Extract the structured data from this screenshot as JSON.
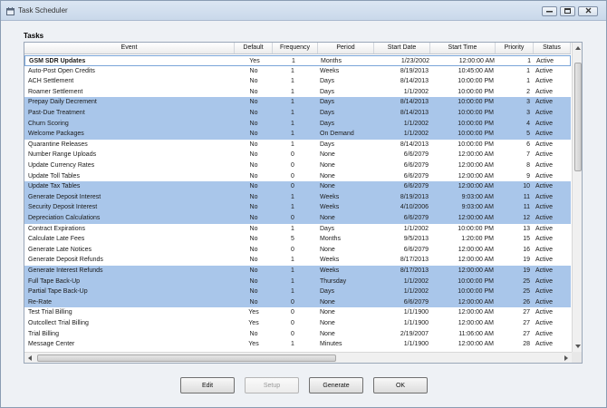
{
  "window": {
    "title": "Task Scheduler",
    "group_label": "Tasks"
  },
  "columns": {
    "event": "Event",
    "default": "Default",
    "frequency": "Frequency",
    "period": "Period",
    "start_date": "Start Date",
    "start_time": "Start Time",
    "priority": "Priority",
    "status": "Status"
  },
  "rows": [
    {
      "event": "GSM SDR Updates",
      "default": "Yes",
      "frequency": "1",
      "period": "Months",
      "start_date": "1/23/2002",
      "start_time": "12:00:00 AM",
      "priority": "1",
      "status": "Active",
      "highlight": false,
      "selected": true,
      "bold": true
    },
    {
      "event": "Auto-Post Open Credits",
      "default": "No",
      "frequency": "1",
      "period": "Weeks",
      "start_date": "8/19/2013",
      "start_time": "10:45:00 AM",
      "priority": "1",
      "status": "Active",
      "highlight": false
    },
    {
      "event": "ACH Settlement",
      "default": "No",
      "frequency": "1",
      "period": "Days",
      "start_date": "8/14/2013",
      "start_time": "10:00:00 PM",
      "priority": "1",
      "status": "Active",
      "highlight": false
    },
    {
      "event": "Roamer Settlement",
      "default": "No",
      "frequency": "1",
      "period": "Days",
      "start_date": "1/1/2002",
      "start_time": "10:00:00 PM",
      "priority": "2",
      "status": "Active",
      "highlight": false
    },
    {
      "event": "Prepay Daily Decrement",
      "default": "No",
      "frequency": "1",
      "period": "Days",
      "start_date": "8/14/2013",
      "start_time": "10:00:00 PM",
      "priority": "3",
      "status": "Active",
      "highlight": true
    },
    {
      "event": "Past-Due Treatment",
      "default": "No",
      "frequency": "1",
      "period": "Days",
      "start_date": "8/14/2013",
      "start_time": "10:00:00 PM",
      "priority": "3",
      "status": "Active",
      "highlight": true
    },
    {
      "event": "Churn Scoring",
      "default": "No",
      "frequency": "1",
      "period": "Days",
      "start_date": "1/1/2002",
      "start_time": "10:00:00 PM",
      "priority": "4",
      "status": "Active",
      "highlight": true
    },
    {
      "event": "Welcome Packages",
      "default": "No",
      "frequency": "1",
      "period": "On Demand",
      "start_date": "1/1/2002",
      "start_time": "10:00:00 PM",
      "priority": "5",
      "status": "Active",
      "highlight": true
    },
    {
      "event": "Quarantine Releases",
      "default": "No",
      "frequency": "1",
      "period": "Days",
      "start_date": "8/14/2013",
      "start_time": "10:00:00 PM",
      "priority": "6",
      "status": "Active",
      "highlight": false
    },
    {
      "event": "Number Range Uploads",
      "default": "No",
      "frequency": "0",
      "period": "None",
      "start_date": "6/6/2079",
      "start_time": "12:00:00 AM",
      "priority": "7",
      "status": "Active",
      "highlight": false
    },
    {
      "event": "Update Currency Rates",
      "default": "No",
      "frequency": "0",
      "period": "None",
      "start_date": "6/6/2079",
      "start_time": "12:00:00 AM",
      "priority": "8",
      "status": "Active",
      "highlight": false
    },
    {
      "event": "Update Toll Tables",
      "default": "No",
      "frequency": "0",
      "period": "None",
      "start_date": "6/6/2079",
      "start_time": "12:00:00 AM",
      "priority": "9",
      "status": "Active",
      "highlight": false
    },
    {
      "event": "Update Tax Tables",
      "default": "No",
      "frequency": "0",
      "period": "None",
      "start_date": "6/6/2079",
      "start_time": "12:00:00 AM",
      "priority": "10",
      "status": "Active",
      "highlight": true
    },
    {
      "event": "Generate Deposit Interest",
      "default": "No",
      "frequency": "1",
      "period": "Weeks",
      "start_date": "8/19/2013",
      "start_time": "9:03:00 AM",
      "priority": "11",
      "status": "Active",
      "highlight": true
    },
    {
      "event": "Security Deposit Interest",
      "default": "No",
      "frequency": "1",
      "period": "Weeks",
      "start_date": "4/10/2006",
      "start_time": "9:03:00 AM",
      "priority": "11",
      "status": "Active",
      "highlight": true
    },
    {
      "event": "Depreciation Calculations",
      "default": "No",
      "frequency": "0",
      "period": "None",
      "start_date": "6/6/2079",
      "start_time": "12:00:00 AM",
      "priority": "12",
      "status": "Active",
      "highlight": true
    },
    {
      "event": "Contract Expirations",
      "default": "No",
      "frequency": "1",
      "period": "Days",
      "start_date": "1/1/2002",
      "start_time": "10:00:00 PM",
      "priority": "13",
      "status": "Active",
      "highlight": false
    },
    {
      "event": "Calculate Late Fees",
      "default": "No",
      "frequency": "5",
      "period": "Months",
      "start_date": "9/5/2013",
      "start_time": "1:20:00 PM",
      "priority": "15",
      "status": "Active",
      "highlight": false
    },
    {
      "event": "Generate Late Notices",
      "default": "No",
      "frequency": "0",
      "period": "None",
      "start_date": "6/6/2079",
      "start_time": "12:00:00 AM",
      "priority": "16",
      "status": "Active",
      "highlight": false
    },
    {
      "event": "Generate Deposit Refunds",
      "default": "No",
      "frequency": "1",
      "period": "Weeks",
      "start_date": "8/17/2013",
      "start_time": "12:00:00 AM",
      "priority": "19",
      "status": "Active",
      "highlight": false
    },
    {
      "event": "Generate Interest Refunds",
      "default": "No",
      "frequency": "1",
      "period": "Weeks",
      "start_date": "8/17/2013",
      "start_time": "12:00:00 AM",
      "priority": "19",
      "status": "Active",
      "highlight": true
    },
    {
      "event": "Full Tape Back-Up",
      "default": "No",
      "frequency": "1",
      "period": "Thursday",
      "start_date": "1/1/2002",
      "start_time": "10:00:00 PM",
      "priority": "25",
      "status": "Active",
      "highlight": true
    },
    {
      "event": "Partial Tape Back-Up",
      "default": "No",
      "frequency": "1",
      "period": "Days",
      "start_date": "1/1/2002",
      "start_time": "10:00:00 PM",
      "priority": "25",
      "status": "Active",
      "highlight": true
    },
    {
      "event": "Re-Rate",
      "default": "No",
      "frequency": "0",
      "period": "None",
      "start_date": "6/6/2079",
      "start_time": "12:00:00 AM",
      "priority": "26",
      "status": "Active",
      "highlight": true
    },
    {
      "event": "Test Trial Billing",
      "default": "Yes",
      "frequency": "0",
      "period": "None",
      "start_date": "1/1/1900",
      "start_time": "12:00:00 AM",
      "priority": "27",
      "status": "Active",
      "highlight": false
    },
    {
      "event": "Outcollect Trial Billing",
      "default": "Yes",
      "frequency": "0",
      "period": "None",
      "start_date": "1/1/1900",
      "start_time": "12:00:00 AM",
      "priority": "27",
      "status": "Active",
      "highlight": false
    },
    {
      "event": "Trial Billing",
      "default": "No",
      "frequency": "0",
      "period": "None",
      "start_date": "2/19/2007",
      "start_time": "11:06:00 AM",
      "priority": "27",
      "status": "Active",
      "highlight": false
    },
    {
      "event": "Message Center",
      "default": "Yes",
      "frequency": "1",
      "period": "Minutes",
      "start_date": "1/1/1900",
      "start_time": "12:00:00 AM",
      "priority": "28",
      "status": "Active",
      "highlight": false
    }
  ],
  "buttons": {
    "edit": "Edit",
    "setup": "Setup",
    "generate": "Generate",
    "ok": "OK"
  },
  "icons": {
    "app": "scheduler-icon",
    "minimize": "minimize-icon",
    "maximize": "maximize-icon",
    "close": "close-icon"
  },
  "colors": {
    "highlight_row": "#a9c6ea",
    "selection_border": "#7aa5d8"
  }
}
